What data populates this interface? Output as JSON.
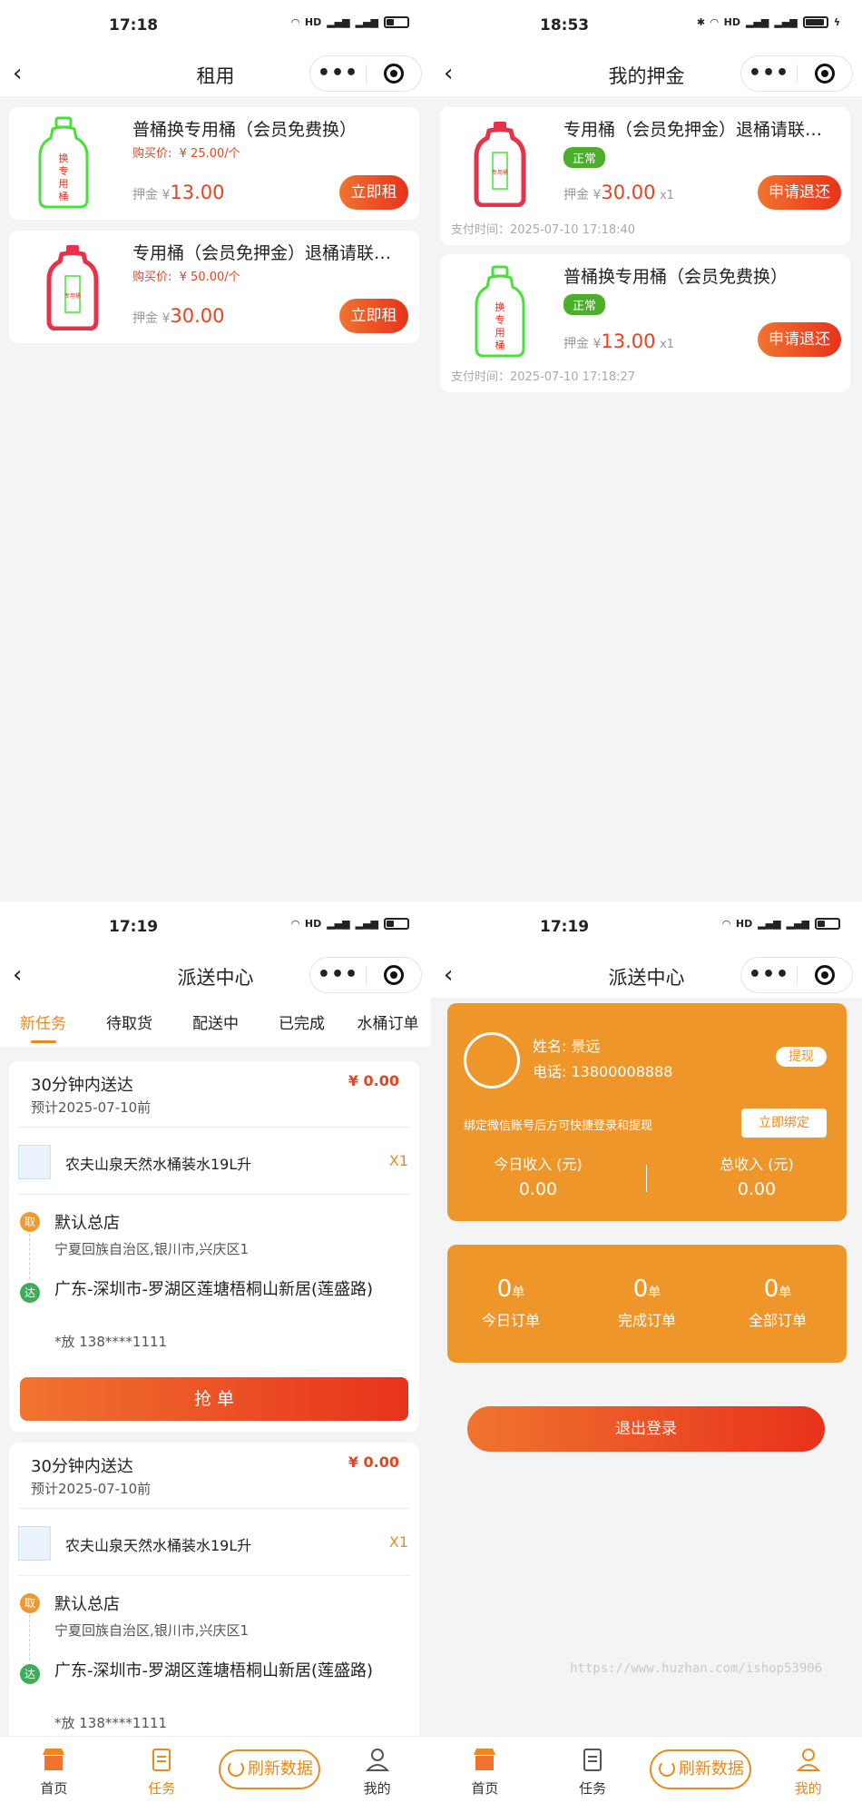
{
  "p1": {
    "status_time": "17:18",
    "title": "租用",
    "items": [
      {
        "name": "普桶换专用桶（会员免费换）",
        "buy_label": "购买价:",
        "buy_price": "¥ 25.00/个",
        "deposit_label": "押金 ¥",
        "deposit": "13.00",
        "button": "立即租",
        "bottle_text": "换专用桶"
      },
      {
        "name": "专用桶（会员免押金）退桶请联…",
        "buy_label": "购买价:",
        "buy_price": "¥ 50.00/个",
        "deposit_label": "押金 ¥",
        "deposit": "30.00",
        "button": "立即租",
        "bottle_text": "专用桶"
      }
    ]
  },
  "p2": {
    "status_time": "18:53",
    "title": "我的押金",
    "items": [
      {
        "name": "专用桶（会员免押金）退桶请联…",
        "status": "正常",
        "deposit_label": "押金 ¥",
        "deposit": "30.00",
        "qty": "x1",
        "button": "申请退还",
        "pay_time": "支付时间：2025-07-10 17:18:40"
      },
      {
        "name": "普桶换专用桶（会员免费换）",
        "status": "正常",
        "deposit_label": "押金 ¥",
        "deposit": "13.00",
        "qty": "x1",
        "button": "申请退还",
        "pay_time": "支付时间：2025-07-10 17:18:27"
      }
    ]
  },
  "p3": {
    "status_time": "17:19",
    "title": "派送中心",
    "tabs": [
      "新任务",
      "待取货",
      "配送中",
      "已完成",
      "水桶订单"
    ],
    "tasks": [
      {
        "title": "30分钟内送达",
        "eta": "预计2025-07-10前",
        "price": "¥ 0.00",
        "goods": "农夫山泉天然水桶装水19L升",
        "qty": "X1",
        "pick_tag": "取",
        "store": "默认总店",
        "store_addr": "宁夏回族自治区,银川市,兴庆区1",
        "dest_tag": "达",
        "dest": "广东-深圳市-罗湖区莲塘梧桐山新居(莲盛路)",
        "phone": "*放 138****1111",
        "button": "抢 单"
      },
      {
        "title": "30分钟内送达",
        "eta": "预计2025-07-10前",
        "price": "¥ 0.00",
        "goods": "农夫山泉天然水桶装水19L升",
        "qty": "X1",
        "pick_tag": "取",
        "store": "默认总店",
        "store_addr": "宁夏回族自治区,银川市,兴庆区1",
        "dest_tag": "达",
        "dest": "广东-深圳市-罗湖区莲塘梧桐山新居(莲盛路)",
        "phone": "*放 138****1111"
      }
    ],
    "tabbar": {
      "home": "首页",
      "task": "任务",
      "refresh": "刷新数据",
      "mine": "我的"
    }
  },
  "p4": {
    "status_time": "17:19",
    "title": "派送中心",
    "name_line": "姓名:  景远",
    "phone_line": "电话:  13800008888",
    "withdraw": "提现",
    "bind_tip": "绑定微信账号后方可快捷登录和提现",
    "bind_button": "立即绑定",
    "today_income_label": "今日收入 (元)",
    "today_income": "0.00",
    "total_income_label": "总收入 (元)",
    "total_income": "0.00",
    "stats": [
      {
        "num": "0",
        "unit": "单",
        "label": "今日订单"
      },
      {
        "num": "0",
        "unit": "单",
        "label": "完成订单"
      },
      {
        "num": "0",
        "unit": "单",
        "label": "全部订单"
      }
    ],
    "logout": "退出登录",
    "tabbar": {
      "home": "首页",
      "task": "任务",
      "refresh": "刷新数据",
      "mine": "我的"
    }
  },
  "watermark": "https://www.huzhan.com/ishop53906",
  "colors": {
    "accent": "#e98a1d",
    "orange_card": "#ef962a",
    "price_red": "#e8431e",
    "green": "#4caf2b"
  }
}
